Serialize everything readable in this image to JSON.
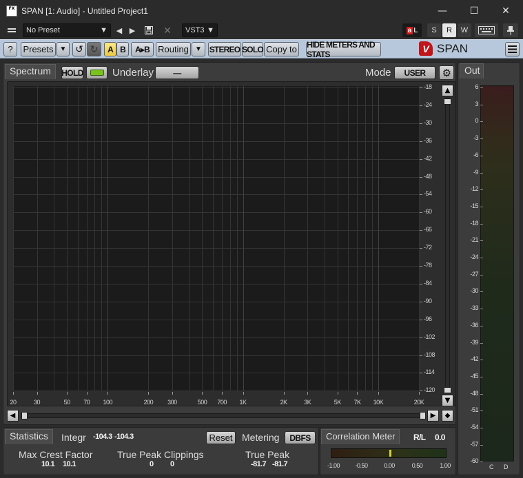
{
  "window": {
    "title": "SPAN [1: Audio] - Untitled Project1",
    "icon_text": "FX",
    "minimize": "—",
    "maximize": "☐",
    "close": "✕"
  },
  "host": {
    "preset_value": "No Preset",
    "format_value": "VST3",
    "toggles": [
      "S",
      "R",
      "W"
    ]
  },
  "toolbar": {
    "help": "?",
    "presets": "Presets",
    "a": "A",
    "b": "B",
    "atob": "A▸B",
    "routing": "Routing",
    "stereo": "STEREO",
    "solo": "SOLO",
    "copy_to": "Copy to",
    "hide_meters": "HIDE METERS AND STATS",
    "brand_mark": "V",
    "brand": "SPAN"
  },
  "spectrum": {
    "tab": "Spectrum",
    "hold": "HOLD",
    "underlay_label": "Underlay",
    "underlay_value": "—",
    "mode_label": "Mode",
    "mode_value": "USER",
    "y_labels": [
      "-18",
      "-24",
      "-30",
      "-36",
      "-42",
      "-48",
      "-54",
      "-60",
      "-66",
      "-72",
      "-78",
      "-84",
      "-90",
      "-96",
      "-102",
      "-108",
      "-114",
      "-120"
    ],
    "x_labels": [
      "20",
      "30",
      "50",
      "70",
      "100",
      "200",
      "300",
      "500",
      "700",
      "1K",
      "2K",
      "3K",
      "5K",
      "7K",
      "10K",
      "20K"
    ]
  },
  "statistics": {
    "tab": "Statistics",
    "integr_label": "Integr",
    "integr_l": "-104.3",
    "integr_r": "-104.3",
    "reset": "Reset",
    "metering_label": "Metering",
    "metering_value": "DBFS",
    "max_crest_label": "Max Crest Factor",
    "max_crest_l": "10.1",
    "max_crest_r": "10.1",
    "tp_clip_label": "True Peak Clippings",
    "tp_clip_l": "0",
    "tp_clip_r": "0",
    "tp_label": "True Peak",
    "tp_l": "-81.7",
    "tp_r": "-81.7"
  },
  "correlation": {
    "tab": "Correlation Meter",
    "mode": "R/L",
    "value": "0.0",
    "level": 0.0,
    "labels": [
      "-1.00",
      "-0.50",
      "0.00",
      "0.50",
      "1.00"
    ]
  },
  "out": {
    "tab": "Out",
    "labels": [
      "6",
      "3",
      "0",
      "-3",
      "-6",
      "-9",
      "-12",
      "-15",
      "-18",
      "-21",
      "-24",
      "-27",
      "-30",
      "-33",
      "-36",
      "-39",
      "-42",
      "-45",
      "-48",
      "-51",
      "-54",
      "-57",
      "-60"
    ],
    "channels": [
      "C",
      "D"
    ]
  },
  "colors": {
    "accent_yellow": "#e8c843",
    "hold_led": "#79c21f",
    "brand_red": "#c0151b",
    "meter_needle": "#d8d430"
  }
}
